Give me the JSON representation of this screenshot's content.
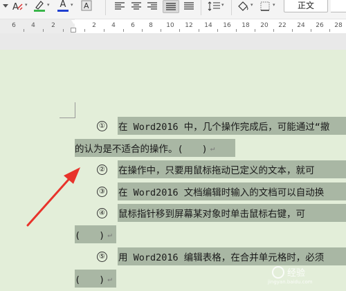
{
  "toolbar": {
    "font_color_glyph": "A",
    "style_name": "正文",
    "accent_colors": {
      "highlight": "#39b54a",
      "font_color": "#1f3fd0"
    }
  },
  "ruler": {
    "numbers": [
      "6",
      "4",
      "2",
      "2",
      "4",
      "6",
      "8",
      "10",
      "12",
      "14",
      "16",
      "18",
      "20",
      "22",
      "24",
      "26",
      "28"
    ]
  },
  "document": {
    "lines": [
      {
        "marker": "①",
        "text": "在 Word2016 中，几个操作完成后，可能通过“撤"
      },
      {
        "marker": "",
        "text": "的认为是不适合的操作。(　　)"
      },
      {
        "marker": "②",
        "text": "在操作中，只要用鼠标拖动已定义的文本，就可"
      },
      {
        "marker": "③",
        "text": "在 Word2016 文档编辑时输入的文档可以自动换"
      },
      {
        "marker": "④",
        "text": "鼠标指针移到屏幕某对象时单击鼠标右键，可"
      },
      {
        "marker": "",
        "text": "(　　)"
      },
      {
        "marker": "⑤",
        "text": "用 Word2016 编辑表格，在合并单元格时，必须"
      },
      {
        "marker": "",
        "text": "(　　)"
      }
    ],
    "paragraph_mark": "↵",
    "highlight_color": "#a9b7a4",
    "arrow_color": "#e8332b"
  },
  "watermark": {
    "text": "经验",
    "site": "jingyan.baidu.com"
  }
}
